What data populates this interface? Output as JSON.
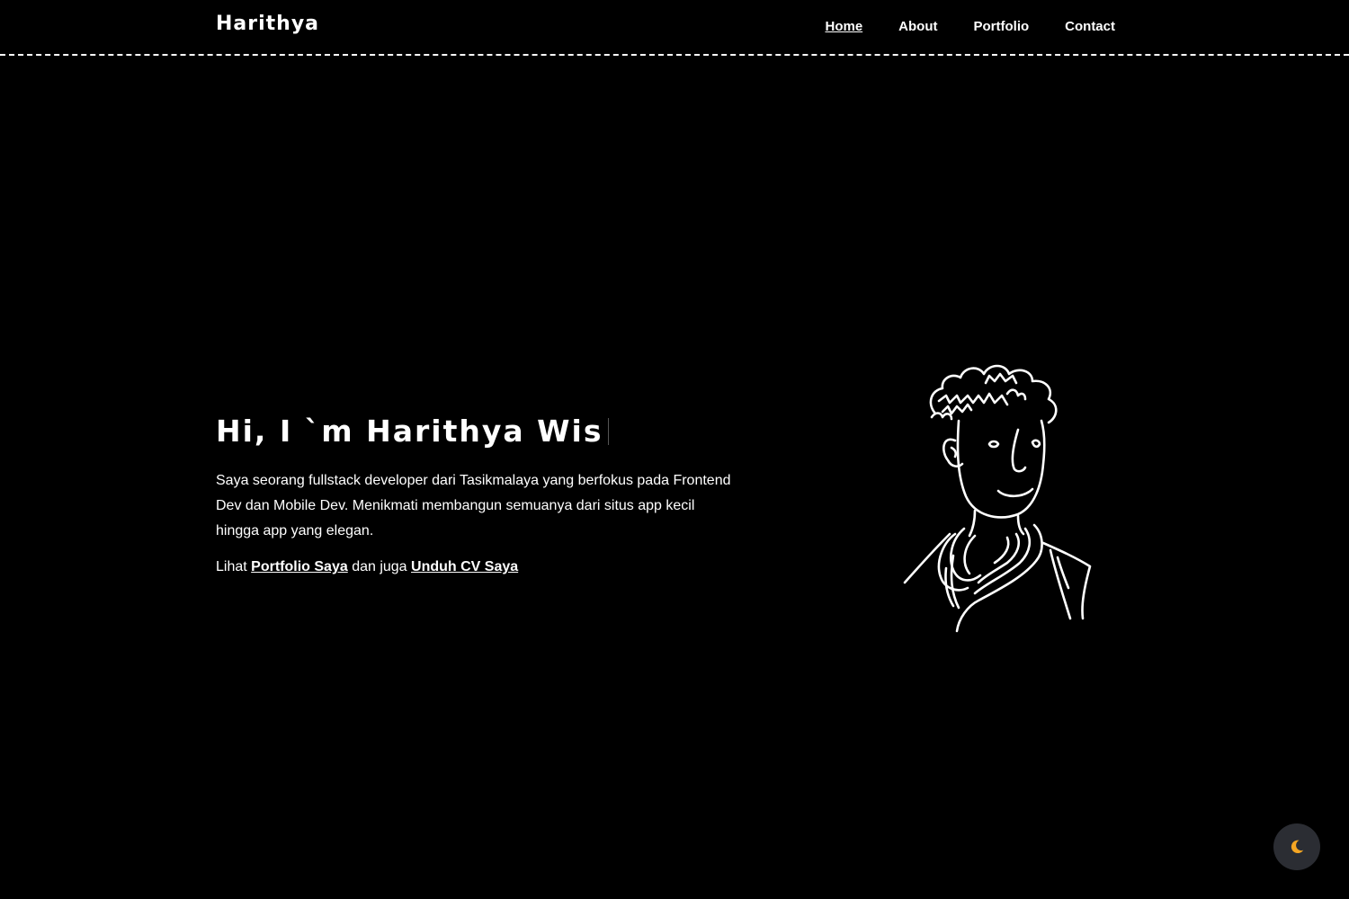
{
  "header": {
    "logo": "Harithya",
    "nav": [
      {
        "label": "Home"
      },
      {
        "label": "About"
      },
      {
        "label": "Portfolio"
      },
      {
        "label": "Contact"
      }
    ]
  },
  "hero": {
    "heading": "Hi, I `m Harithya Wis",
    "description": "Saya seorang fullstack developer dari Tasikmalaya yang berfokus pada Frontend Dev dan Mobile Dev. Menikmati membangun semuanya dari situs app kecil hingga app yang elegan.",
    "links_prefix": "Lihat",
    "portfolio_link": "Portfolio Saya",
    "links_middle": "dan juga",
    "cv_link": "Unduh CV Saya"
  },
  "theme_toggle": {
    "icon": "moon-icon",
    "icon_color": "#f5a623"
  },
  "colors": {
    "background": "#000000",
    "text": "#ffffff",
    "toggle_bg": "#2b2d33"
  }
}
